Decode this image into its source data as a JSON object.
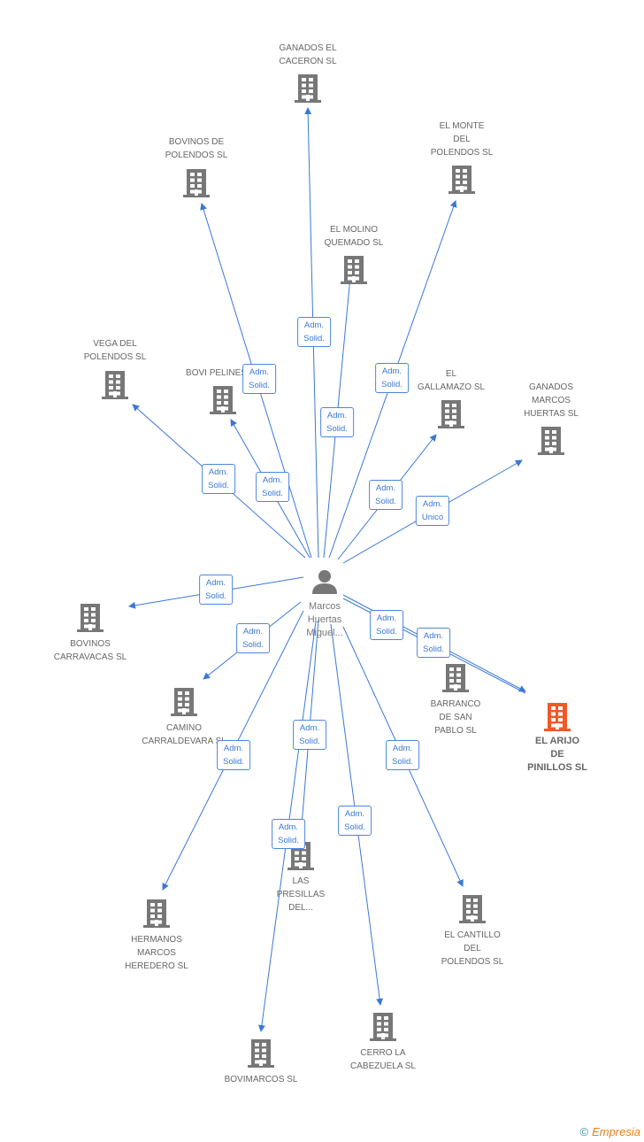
{
  "person": {
    "name_lines": [
      "Marcos",
      "Huertas",
      "Miguel..."
    ],
    "icon": "person-icon"
  },
  "colors": {
    "edge": "#3a78d8",
    "company": "#777777",
    "main_company": "#f05a28"
  },
  "companies": [
    {
      "lines": [
        "GANADOS EL",
        "CACERON SL"
      ]
    },
    {
      "lines": [
        "BOVINOS DE",
        "POLENDOS SL"
      ]
    },
    {
      "lines": [
        "EL MONTE",
        "DEL",
        "POLENDOS SL"
      ]
    },
    {
      "lines": [
        "EL MOLINO",
        "QUEMADO SL"
      ]
    },
    {
      "lines": [
        "VEGA DEL",
        "POLENDOS SL"
      ]
    },
    {
      "lines": [
        "BOVI PELINES SL"
      ]
    },
    {
      "lines": [
        "EL",
        "GALLAMAZO SL"
      ]
    },
    {
      "lines": [
        "GANADOS",
        "MARCOS",
        "HUERTAS SL"
      ]
    },
    {
      "lines": [
        "BOVINOS",
        "CARRAVACAS SL"
      ]
    },
    {
      "lines": [
        "CAMINO",
        "CARRALDEVARA SL"
      ]
    },
    {
      "lines": [
        "BARRANCO",
        "DE SAN",
        "PABLO SL"
      ]
    },
    {
      "lines": [
        "EL ARIJO",
        "DE",
        "PINILLOS SL"
      ],
      "main": true
    },
    {
      "lines": [
        "LAS",
        "PRESILLAS",
        "DEL..."
      ]
    },
    {
      "lines": [
        "HERMANOS",
        "MARCOS",
        "HEREDERO SL"
      ]
    },
    {
      "lines": [
        "EL CANTILLO",
        "DEL",
        "POLENDOS SL"
      ]
    },
    {
      "lines": [
        "BOVIMARCOS SL"
      ]
    },
    {
      "lines": [
        "CERRO LA",
        "CABEZUELA SL"
      ]
    }
  ],
  "edge_labels": [
    {
      "lines": [
        "Adm.",
        "Solid."
      ]
    },
    {
      "lines": [
        "Adm.",
        "Solid."
      ]
    },
    {
      "lines": [
        "Adm.",
        "Solid."
      ]
    },
    {
      "lines": [
        "Adm.",
        "Solid."
      ]
    },
    {
      "lines": [
        "Adm.",
        "Solid."
      ]
    },
    {
      "lines": [
        "Adm.",
        "Solid."
      ]
    },
    {
      "lines": [
        "Adm.",
        "Solid."
      ]
    },
    {
      "lines": [
        "Adm.",
        "Unico"
      ]
    },
    {
      "lines": [
        "Adm.",
        "Solid."
      ]
    },
    {
      "lines": [
        "Adm.",
        "Solid."
      ]
    },
    {
      "lines": [
        "Adm.",
        "Solid."
      ]
    },
    {
      "lines": [
        "Adm.",
        "Solid."
      ]
    },
    {
      "lines": [
        "Adm.",
        "Solid."
      ]
    },
    {
      "lines": [
        "Adm.",
        "Solid."
      ]
    },
    {
      "lines": [
        "Adm.",
        "Solid."
      ]
    },
    {
      "lines": [
        "Adm.",
        "Solid."
      ]
    },
    {
      "lines": [
        "Adm.",
        "Solid."
      ]
    }
  ],
  "footer": {
    "copyright": "©",
    "brand": "Empresia"
  }
}
